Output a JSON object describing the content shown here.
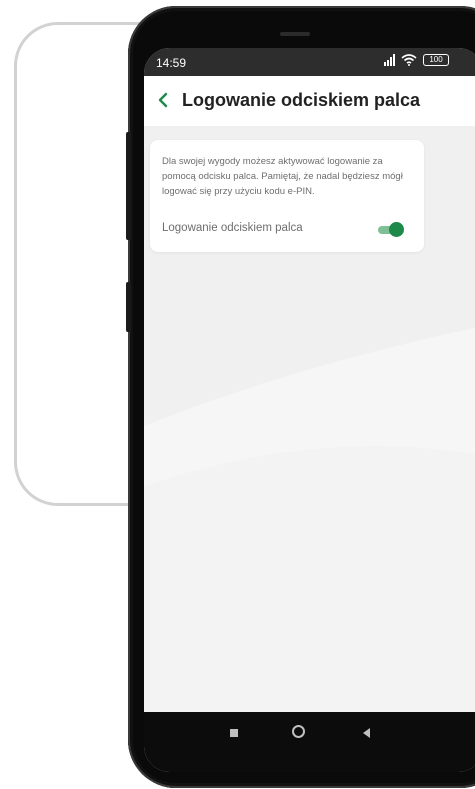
{
  "status_bar": {
    "time": "14:59",
    "battery": "100",
    "icons": [
      "signal-icon",
      "wifi-icon",
      "battery-icon"
    ]
  },
  "header": {
    "title": "Logowanie odciskiem palca",
    "back_icon": "chevron-left-icon"
  },
  "card": {
    "description": "Dla swojej wygody możesz aktywować logowanie za pomocą odcisku palca. Pamiętaj, że nadal będziesz mógł logować się przy użyciu kodu e-PIN.",
    "toggle_label": "Logowanie odciskiem palca",
    "toggle_on": true
  },
  "nav_bar": {
    "buttons": [
      "recents-icon",
      "home-icon",
      "back-icon"
    ]
  },
  "colors": {
    "accent": "#1d8a4a",
    "accent_track": "#7fbf95",
    "screen_bg": "#f0f0f0",
    "status_bar_bg": "#2d2d2d"
  }
}
